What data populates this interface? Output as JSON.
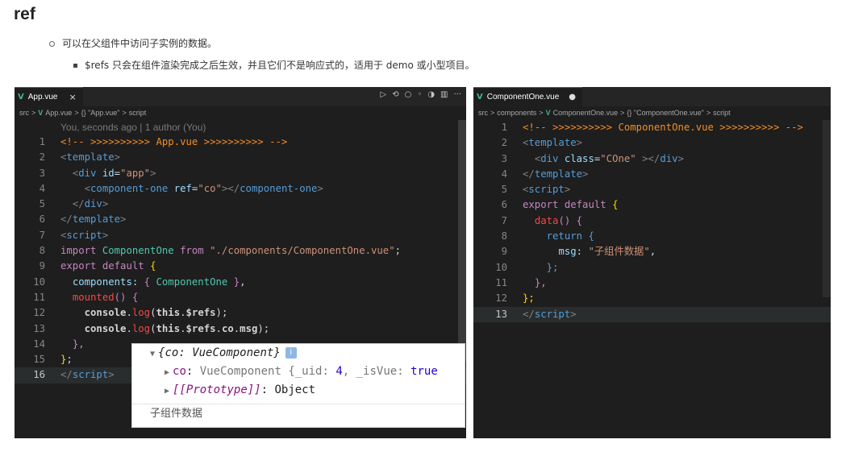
{
  "doc": {
    "title": "ref",
    "bullet1": "可以在父组件中访问子实例的数据。",
    "bullet2": "$refs 只会在组件渲染完成之后生效，并且它们不是响应式的，适用于 demo 或小型项目。"
  },
  "left_editor": {
    "tab_name": "App.vue",
    "close_glyph": "×",
    "actions": [
      "▷",
      "⟲",
      "○",
      "◦",
      "◑",
      "▥",
      "···"
    ],
    "breadcrumb": [
      "src",
      "App.vue",
      "{} \"App.vue\"",
      "script"
    ],
    "blame": "You, seconds ago | 1 author (You)",
    "lines": [
      {
        "n": "1",
        "tokens": [
          [
            "cm",
            "<!-- >>>>>>>>>> App.vue >>>>>>>>>> -->"
          ]
        ]
      },
      {
        "n": "2",
        "tokens": [
          [
            "tg",
            "<"
          ],
          [
            "kw2",
            "template"
          ],
          [
            "tg",
            ">"
          ]
        ]
      },
      {
        "n": "3",
        "tokens": [
          [
            "tx",
            "  "
          ],
          [
            "tg",
            "<"
          ],
          [
            "kw2",
            "div"
          ],
          [
            "tx",
            " "
          ],
          [
            "at",
            "id"
          ],
          [
            "pu",
            "="
          ],
          [
            "st",
            "\"app\""
          ],
          [
            "tg",
            ">"
          ]
        ]
      },
      {
        "n": "4",
        "tokens": [
          [
            "tx",
            "    "
          ],
          [
            "tg",
            "<"
          ],
          [
            "kw2",
            "component-one"
          ],
          [
            "tx",
            " "
          ],
          [
            "at",
            "ref"
          ],
          [
            "pu",
            "="
          ],
          [
            "st",
            "\"co\""
          ],
          [
            "tg",
            "></"
          ],
          [
            "kw2",
            "component-one"
          ],
          [
            "tg",
            ">"
          ]
        ]
      },
      {
        "n": "5",
        "tokens": [
          [
            "tx",
            "  "
          ],
          [
            "tg",
            "</"
          ],
          [
            "kw2",
            "div"
          ],
          [
            "tg",
            ">"
          ]
        ]
      },
      {
        "n": "6",
        "tokens": [
          [
            "tg",
            "</"
          ],
          [
            "kw2",
            "template"
          ],
          [
            "tg",
            ">"
          ]
        ]
      },
      {
        "n": "7",
        "tokens": [
          [
            "tg",
            "<"
          ],
          [
            "kw2",
            "script"
          ],
          [
            "tg",
            ">"
          ]
        ]
      },
      {
        "n": "8",
        "tokens": [
          [
            "kw",
            "import"
          ],
          [
            "tx",
            " "
          ],
          [
            "cl",
            "ComponentOne"
          ],
          [
            "tx",
            " "
          ],
          [
            "kw",
            "from"
          ],
          [
            "tx",
            " "
          ],
          [
            "st",
            "\"./components/ComponentOne.vue\""
          ],
          [
            "pu",
            ";"
          ]
        ]
      },
      {
        "n": "9",
        "tokens": [
          [
            "kw",
            "export"
          ],
          [
            "tx",
            " "
          ],
          [
            "kw",
            "default"
          ],
          [
            "tx",
            " "
          ],
          [
            "br",
            "{"
          ]
        ]
      },
      {
        "n": "10",
        "tokens": [
          [
            "tx",
            "  "
          ],
          [
            "at",
            "components"
          ],
          [
            "pu",
            ": "
          ],
          [
            "kw",
            "{"
          ],
          [
            "tx",
            " "
          ],
          [
            "cl",
            "ComponentOne"
          ],
          [
            "tx",
            " "
          ],
          [
            "kw",
            "}"
          ],
          [
            "pu",
            ","
          ]
        ]
      },
      {
        "n": "11",
        "tokens": [
          [
            "tx",
            "  "
          ],
          [
            "pk",
            "mounted"
          ],
          [
            "kw",
            "()"
          ],
          [
            "tx",
            " "
          ],
          [
            "kw",
            "{"
          ]
        ]
      },
      {
        "n": "12",
        "tokens": [
          [
            "tx",
            "    "
          ],
          [
            "var",
            "console"
          ],
          [
            "pu",
            "."
          ],
          [
            "pk",
            "log"
          ],
          [
            "pu",
            "("
          ],
          [
            "var",
            "this"
          ],
          [
            "pu",
            "."
          ],
          [
            "var",
            "$refs"
          ],
          [
            "pu",
            ");"
          ]
        ]
      },
      {
        "n": "13",
        "tokens": [
          [
            "tx",
            "    "
          ],
          [
            "var",
            "console"
          ],
          [
            "pu",
            "."
          ],
          [
            "pk",
            "log"
          ],
          [
            "pu",
            "("
          ],
          [
            "var",
            "this"
          ],
          [
            "pu",
            "."
          ],
          [
            "var",
            "$refs"
          ],
          [
            "pu",
            "."
          ],
          [
            "var",
            "co"
          ],
          [
            "pu",
            "."
          ],
          [
            "var",
            "msg"
          ],
          [
            "pu",
            ");"
          ]
        ]
      },
      {
        "n": "14",
        "tokens": [
          [
            "tx",
            "  "
          ],
          [
            "kw",
            "},"
          ]
        ]
      },
      {
        "n": "15",
        "tokens": [
          [
            "br",
            "}"
          ],
          [
            "pu",
            ";"
          ]
        ]
      },
      {
        "n": "16",
        "tokens": [
          [
            "tg",
            "</"
          ],
          [
            "kw2",
            "script"
          ],
          [
            "tg",
            ">"
          ]
        ]
      }
    ]
  },
  "right_editor": {
    "tab_name": "ComponentOne.vue",
    "modified_glyph": "●",
    "breadcrumb": [
      "src",
      "components",
      "ComponentOne.vue",
      "{} \"ComponentOne.vue\"",
      "script"
    ],
    "lines": [
      {
        "n": "1",
        "tokens": [
          [
            "cm",
            "<!-- >>>>>>>>>> ComponentOne.vue >>>>>>>>>> -->"
          ]
        ]
      },
      {
        "n": "2",
        "tokens": [
          [
            "tg",
            "<"
          ],
          [
            "kw2",
            "template"
          ],
          [
            "tg",
            ">"
          ]
        ]
      },
      {
        "n": "3",
        "tokens": [
          [
            "tx",
            "  "
          ],
          [
            "tg",
            "<"
          ],
          [
            "kw2",
            "div"
          ],
          [
            "tx",
            " "
          ],
          [
            "at",
            "class"
          ],
          [
            "pu",
            "="
          ],
          [
            "st",
            "\"COne\""
          ],
          [
            "tx",
            " "
          ],
          [
            "tg",
            "></"
          ],
          [
            "kw2",
            "div"
          ],
          [
            "tg",
            ">"
          ]
        ]
      },
      {
        "n": "4",
        "tokens": [
          [
            "tg",
            "</"
          ],
          [
            "kw2",
            "template"
          ],
          [
            "tg",
            ">"
          ]
        ]
      },
      {
        "n": "5",
        "tokens": [
          [
            "tg",
            "<"
          ],
          [
            "kw2",
            "script"
          ],
          [
            "tg",
            ">"
          ]
        ]
      },
      {
        "n": "6",
        "tokens": [
          [
            "kw",
            "export"
          ],
          [
            "tx",
            " "
          ],
          [
            "kw",
            "default"
          ],
          [
            "tx",
            " "
          ],
          [
            "br",
            "{"
          ]
        ]
      },
      {
        "n": "7",
        "tokens": [
          [
            "tx",
            "  "
          ],
          [
            "pk",
            "data"
          ],
          [
            "kw",
            "()"
          ],
          [
            "tx",
            " "
          ],
          [
            "kw",
            "{"
          ]
        ]
      },
      {
        "n": "8",
        "tokens": [
          [
            "tx",
            "    "
          ],
          [
            "kw2",
            "return"
          ],
          [
            "tx",
            " "
          ],
          [
            "kw2",
            "{"
          ]
        ]
      },
      {
        "n": "9",
        "tokens": [
          [
            "tx",
            "      "
          ],
          [
            "at",
            "msg"
          ],
          [
            "pu",
            ": "
          ],
          [
            "st",
            "\"子组件数据\""
          ],
          [
            "pu",
            ","
          ]
        ]
      },
      {
        "n": "10",
        "tokens": [
          [
            "tx",
            "    "
          ],
          [
            "kw2",
            "};"
          ]
        ]
      },
      {
        "n": "11",
        "tokens": [
          [
            "tx",
            "  "
          ],
          [
            "kw",
            "},"
          ]
        ]
      },
      {
        "n": "12",
        "tokens": [
          [
            "br",
            "};"
          ]
        ]
      },
      {
        "n": "13",
        "tokens": [
          [
            "tg",
            "</"
          ],
          [
            "kw2",
            "script"
          ],
          [
            "tg",
            ">"
          ]
        ]
      }
    ]
  },
  "console": {
    "object_header": "{co: VueComponent}",
    "info_glyph": "i",
    "row1_key": "co",
    "row1_value_prefix": "VueComponent {_uid: ",
    "row1_uid": "4",
    "row1_middle": ", _isVue: ",
    "row1_bool": "true",
    "row2_key": "[[Prototype]]",
    "row2_value": "Object",
    "message": "子组件数据"
  }
}
